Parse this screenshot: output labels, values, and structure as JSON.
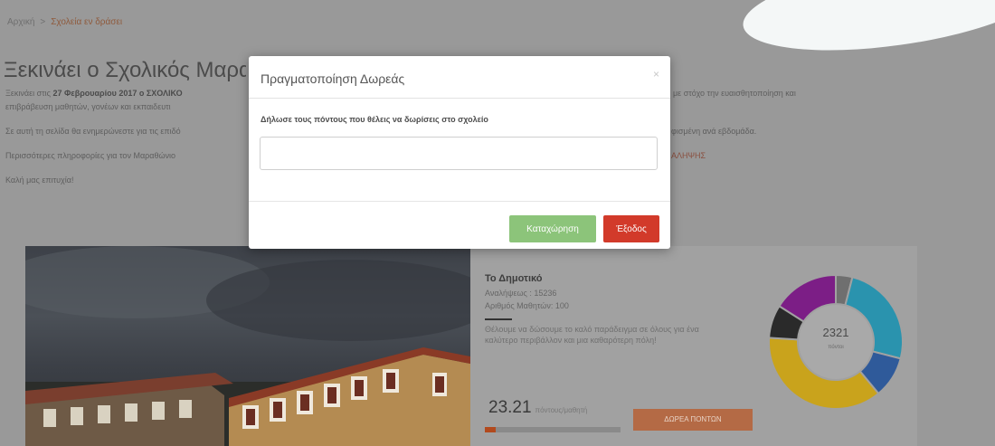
{
  "breadcrumb": {
    "home": "Αρχική",
    "separator": ">",
    "current": "Σχολεία εν δράσει"
  },
  "page": {
    "title": "Ξεκινάει ο Σχολικός Μαραθώνιος",
    "para1_prefix": "Ξεκινάει στις ",
    "para1_bold": "27 Φεβρουαρίου 2017 ο ΣΧΟΛΙΚΟ",
    "para1_line2": "επιβράβευση μαθητών, γονέων και εκπαιδευτι",
    "para1_right": "με στόχο την ευαισθητοποίηση και",
    "para2": "Σε αυτή τη σελίδα θα ενημερώνεστε για τις επιδό",
    "para2_right": "φισμένη ανά εβδομάδα.",
    "para3": "Περισσότερες πληροφορίες για τον Μαραθώνιο",
    "para3_right": "ΑΛΗΨΗΣ",
    "para4": "Καλή μας επιτυχία!"
  },
  "school_card": {
    "name": "Το Δημοτικό",
    "registration": "Αναλήψεως : 15236",
    "students": "Αριθμός Μαθητών: 100",
    "description": "Θέλουμε να δώσουμε το καλό παράδειγμα σε όλους για ένα καλύτερο περιβάλλον και μια καθαρότερη πόλη!",
    "points": "23.21",
    "points_unit": "πόντους/μαθητή",
    "progress_percent": 8,
    "donate_button": "ΔΩΡΕΑ ΠΟΝΤΩΝ",
    "donut_total": "2321",
    "donut_caption": "πόντοι"
  },
  "chart_data": {
    "type": "pie",
    "variant": "donut",
    "values": [
      4,
      25,
      10,
      37,
      8,
      16
    ],
    "colors": [
      "#6f6f6f",
      "#2a93ae",
      "#2f5a9a",
      "#c9a31c",
      "#2a2a2a",
      "#7c1e86"
    ]
  },
  "modal": {
    "title": "Πραγματοποίηση Δωρεάς",
    "close_glyph": "×",
    "label": "Δήλωσε τους πόντους που θέλεις να δωρίσεις στο σχολείο",
    "input_value": "",
    "save_button": "Καταχώρηση",
    "exit_button": "Έξοδος"
  },
  "colors": {
    "save": "#8cc47a",
    "exit": "#d23a2a",
    "accent": "#b24a1e"
  }
}
